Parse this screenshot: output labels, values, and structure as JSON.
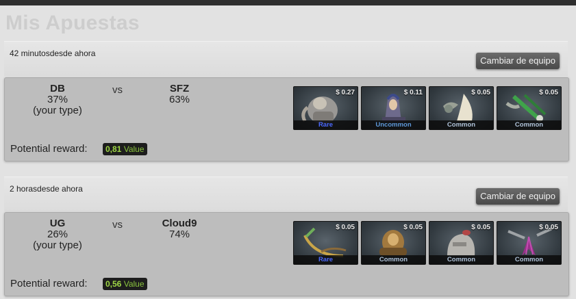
{
  "page": {
    "title": "Mis Apuestas"
  },
  "bets": [
    {
      "time": "42 minutosdesde ahora",
      "change_button": "Cambiar de equipo",
      "team_left": {
        "name": "DB",
        "percent": "37%",
        "note": "(your type)"
      },
      "vs": "vs",
      "team_right": {
        "name": "SFZ",
        "percent": "63%"
      },
      "reward_label": "Potential reward:",
      "reward_amount": "0,81",
      "reward_unit": "Value",
      "items": [
        {
          "price": "$ 0.27",
          "rarity": "Rare",
          "rarity_color": "#4b69ff",
          "icon": "armored-hero-icon"
        },
        {
          "price": "$ 0.11",
          "rarity": "Uncommon",
          "rarity_color": "#5e98d9",
          "icon": "hooded-mage-icon"
        },
        {
          "price": "$ 0.05",
          "rarity": "Common",
          "rarity_color": "#b0c3d9",
          "icon": "white-cloak-icon"
        },
        {
          "price": "$ 0.05",
          "rarity": "Common",
          "rarity_color": "#b0c3d9",
          "icon": "green-weapon-icon"
        }
      ]
    },
    {
      "time": "2 horasdesde ahora",
      "change_button": "Cambiar de equipo",
      "team_left": {
        "name": "UG",
        "percent": "26%",
        "note": "(your type)"
      },
      "vs": "vs",
      "team_right": {
        "name": "Cloud9",
        "percent": "74%"
      },
      "reward_label": "Potential reward:",
      "reward_amount": "0,56",
      "reward_unit": "Value",
      "items": [
        {
          "price": "$ 0.05",
          "rarity": "Rare",
          "rarity_color": "#4b69ff",
          "icon": "golden-bow-icon"
        },
        {
          "price": "$ 0.05",
          "rarity": "Common",
          "rarity_color": "#b0c3d9",
          "icon": "bronze-armor-icon"
        },
        {
          "price": "$ 0.05",
          "rarity": "Common",
          "rarity_color": "#b0c3d9",
          "icon": "stone-helm-icon"
        },
        {
          "price": "$ 0.05",
          "rarity": "Common",
          "rarity_color": "#b0c3d9",
          "icon": "purple-spikes-icon"
        }
      ]
    }
  ]
}
